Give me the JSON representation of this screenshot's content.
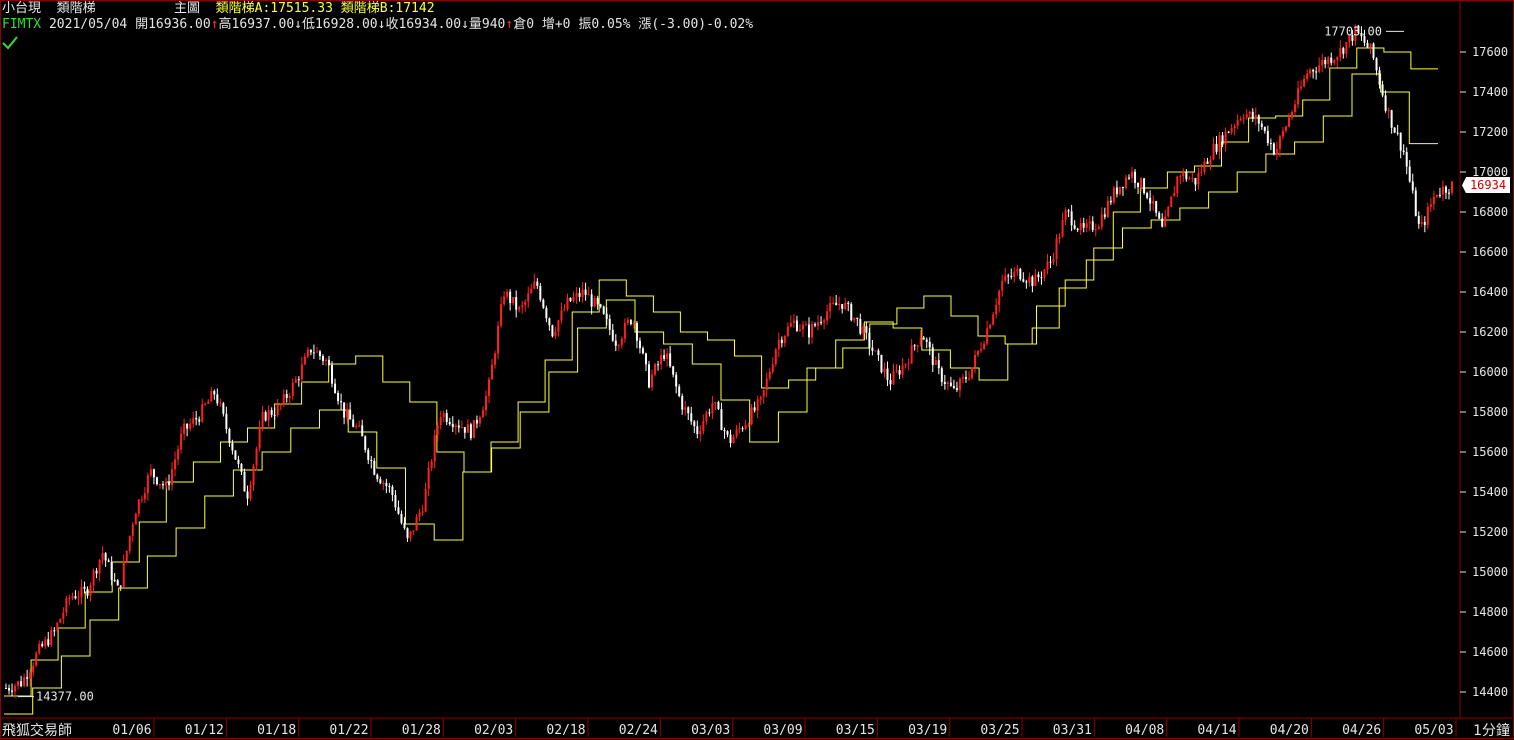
{
  "header": {
    "instrument": "小台現",
    "indicator": "類階梯",
    "main_chart_label": "主圖",
    "ladder_a": "類階梯A:17515.33",
    "ladder_b": "類階梯B:17142",
    "symbol": "FIMTX",
    "date": "2021/05/04",
    "open": "開16936.00",
    "high": "高16937.00",
    "low": "低16928.00",
    "close": "收16934.00",
    "volume": "量940",
    "oi": "倉0",
    "oi_change": "增+0",
    "amplitude": "振0.05%",
    "change": "漲(-3.00)-0.02%",
    "arrow_up": "↑",
    "arrow_down": "↓"
  },
  "footer": {
    "brand": "飛狐交易師",
    "period": "1分鐘"
  },
  "colors": {
    "background": "#000000",
    "ladder": "#ffff33",
    "bar_up": "#ff2020",
    "bar_down": "#ffffff",
    "border": "#8b0000"
  },
  "chart_data": {
    "type": "line",
    "ylim": [
      14280,
      17760
    ],
    "y_ticks": [
      14400,
      14600,
      14800,
      15000,
      15200,
      15400,
      15600,
      15800,
      16000,
      16200,
      16400,
      16600,
      16800,
      17000,
      17200,
      17400,
      17600
    ],
    "x_labels": [
      "01/06",
      "01/12",
      "01/18",
      "01/22",
      "01/28",
      "02/03",
      "02/18",
      "02/24",
      "03/03",
      "03/09",
      "03/15",
      "03/19",
      "03/25",
      "03/31",
      "04/08",
      "04/14",
      "04/20",
      "04/26",
      "05/03"
    ],
    "max_label": "17703.00",
    "min_label": "14377.00",
    "last_price": "16934",
    "price_series": [
      14420,
      14450,
      14600,
      14700,
      14880,
      14900,
      15100,
      14900,
      15300,
      15500,
      15420,
      15700,
      15780,
      15900,
      15650,
      15380,
      15780,
      15820,
      15950,
      16120,
      16050,
      15800,
      15700,
      15500,
      15400,
      15150,
      15350,
      15800,
      15750,
      15700,
      15900,
      16400,
      16300,
      16450,
      16200,
      16350,
      16400,
      16300,
      16150,
      16280,
      15950,
      16100,
      15850,
      15700,
      15850,
      15650,
      15750,
      15850,
      16150,
      16250,
      16200,
      16300,
      16350,
      16250,
      16100,
      15950,
      16050,
      16200,
      16000,
      15900,
      16000,
      16200,
      16450,
      16500,
      16450,
      16550,
      16800,
      16700,
      16750,
      16900,
      17000,
      16900,
      16700,
      17000,
      16950,
      17100,
      17200,
      17300,
      17250,
      17100,
      17300,
      17500,
      17550,
      17600,
      17703,
      17600,
      17300,
      17100,
      16700,
      16900,
      16934
    ],
    "ladder_a": [
      14380,
      14560,
      14720,
      14900,
      15050,
      15250,
      15450,
      15550,
      15650,
      15720,
      15840,
      15950,
      16040,
      16080,
      15950,
      15850,
      15600,
      15500,
      15650,
      15850,
      16060,
      16300,
      16460,
      16380,
      16300,
      16200,
      16160,
      16080,
      15920,
      15960,
      16020,
      16120,
      16240,
      16320,
      16380,
      16280,
      16180,
      16140,
      16220,
      16420,
      16560,
      16800,
      16920,
      17000,
      17030,
      17150,
      17270,
      17280,
      17360,
      17520,
      17620,
      17600,
      17515.33
    ],
    "ladder_b": [
      14290,
      14420,
      14580,
      14760,
      14920,
      15080,
      15220,
      15380,
      15510,
      15600,
      15720,
      15810,
      15700,
      15520,
      15240,
      15160,
      15500,
      15620,
      15800,
      16000,
      16220,
      16360,
      16200,
      16140,
      16040,
      15860,
      15650,
      15800,
      16020,
      16160,
      16250,
      16220,
      16110,
      16020,
      15960,
      16140,
      16330,
      16460,
      16620,
      16720,
      16760,
      16820,
      16900,
      17000,
      17090,
      17150,
      17280,
      17490,
      17400,
      17142
    ]
  }
}
